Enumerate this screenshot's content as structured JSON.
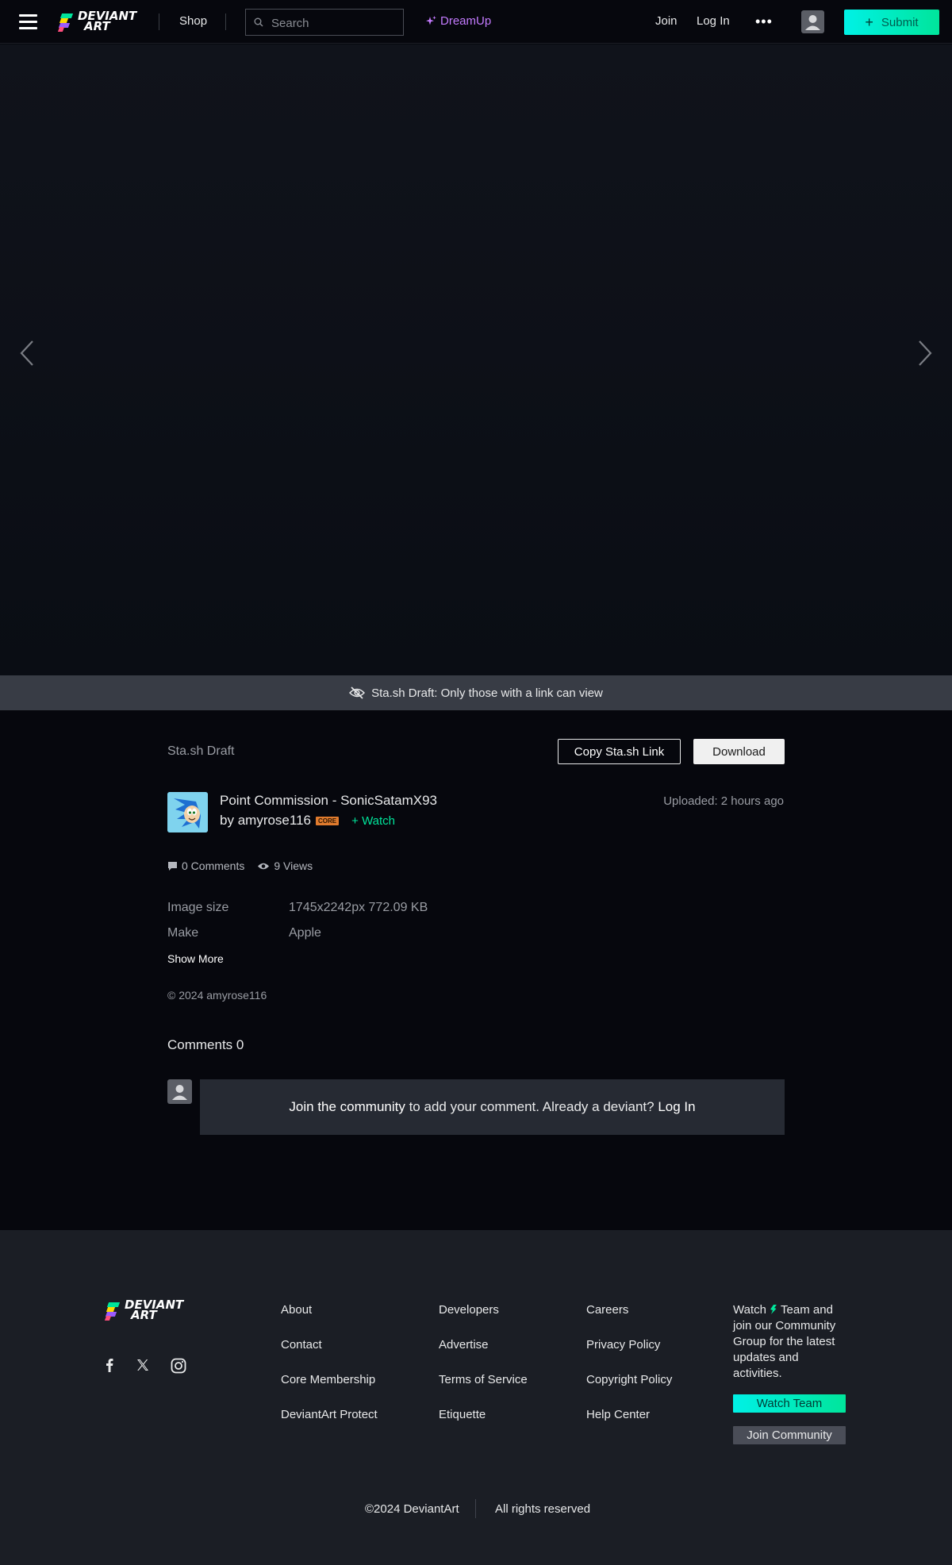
{
  "header": {
    "brand_line1": "DEVIANT",
    "brand_line2": "ART",
    "shop": "Shop",
    "search_placeholder": "Search",
    "dreamup": "DreamUp",
    "join": "Join",
    "login": "Log In",
    "more": "•••",
    "submit": "Submit"
  },
  "banner": {
    "text": "Sta.sh Draft: Only those with a link can view"
  },
  "deviation": {
    "section_title": "Sta.sh Draft",
    "copy_link": "Copy Sta.sh Link",
    "download": "Download",
    "title": "Point Commission - SonicSatamX93",
    "by_prefix": "by",
    "author": "amyrose116",
    "badge": "CORE",
    "watch": "Watch",
    "uploaded": "Uploaded: 2 hours ago",
    "comments_count": "0 Comments",
    "views_count": "9 Views",
    "meta": [
      {
        "label": "Image size",
        "value": "1745x2242px 772.09 KB"
      },
      {
        "label": "Make",
        "value": "Apple"
      }
    ],
    "show_more": "Show More",
    "copyright": "© 2024 amyrose116"
  },
  "comments": {
    "heading": "Comments 0",
    "join_text": "Join the community",
    "middle_text": " to add your comment. Already a deviant? ",
    "login_text": "Log In"
  },
  "footer": {
    "col1": [
      "About",
      "Contact",
      "Core Membership",
      "DeviantArt Protect"
    ],
    "col2": [
      "Developers",
      "Advertise",
      "Terms of Service",
      "Etiquette"
    ],
    "col3": [
      "Careers",
      "Privacy Policy",
      "Copyright Policy",
      "Help Center"
    ],
    "about_pre": "Watch",
    "about_post": "Team and join our Community Group for the latest updates and activities.",
    "watch_team": "Watch Team",
    "join_community": "Join Community",
    "copyright": "©2024 DeviantArt",
    "rights": "All rights reserved"
  },
  "colors": {
    "accent": "#00e59b",
    "accent_cyan": "#00f1e6",
    "dreamup": "#c47bff",
    "background": "#06070d",
    "footer_bg": "#1b1e25"
  },
  "icons": [
    "hamburger-icon",
    "search-icon",
    "sparkle-icon",
    "more-icon",
    "user-icon",
    "plus-icon",
    "chevron-left-icon",
    "chevron-right-icon",
    "eye-off-icon",
    "comment-icon",
    "eye-icon",
    "facebook-icon",
    "x-icon",
    "instagram-icon"
  ]
}
